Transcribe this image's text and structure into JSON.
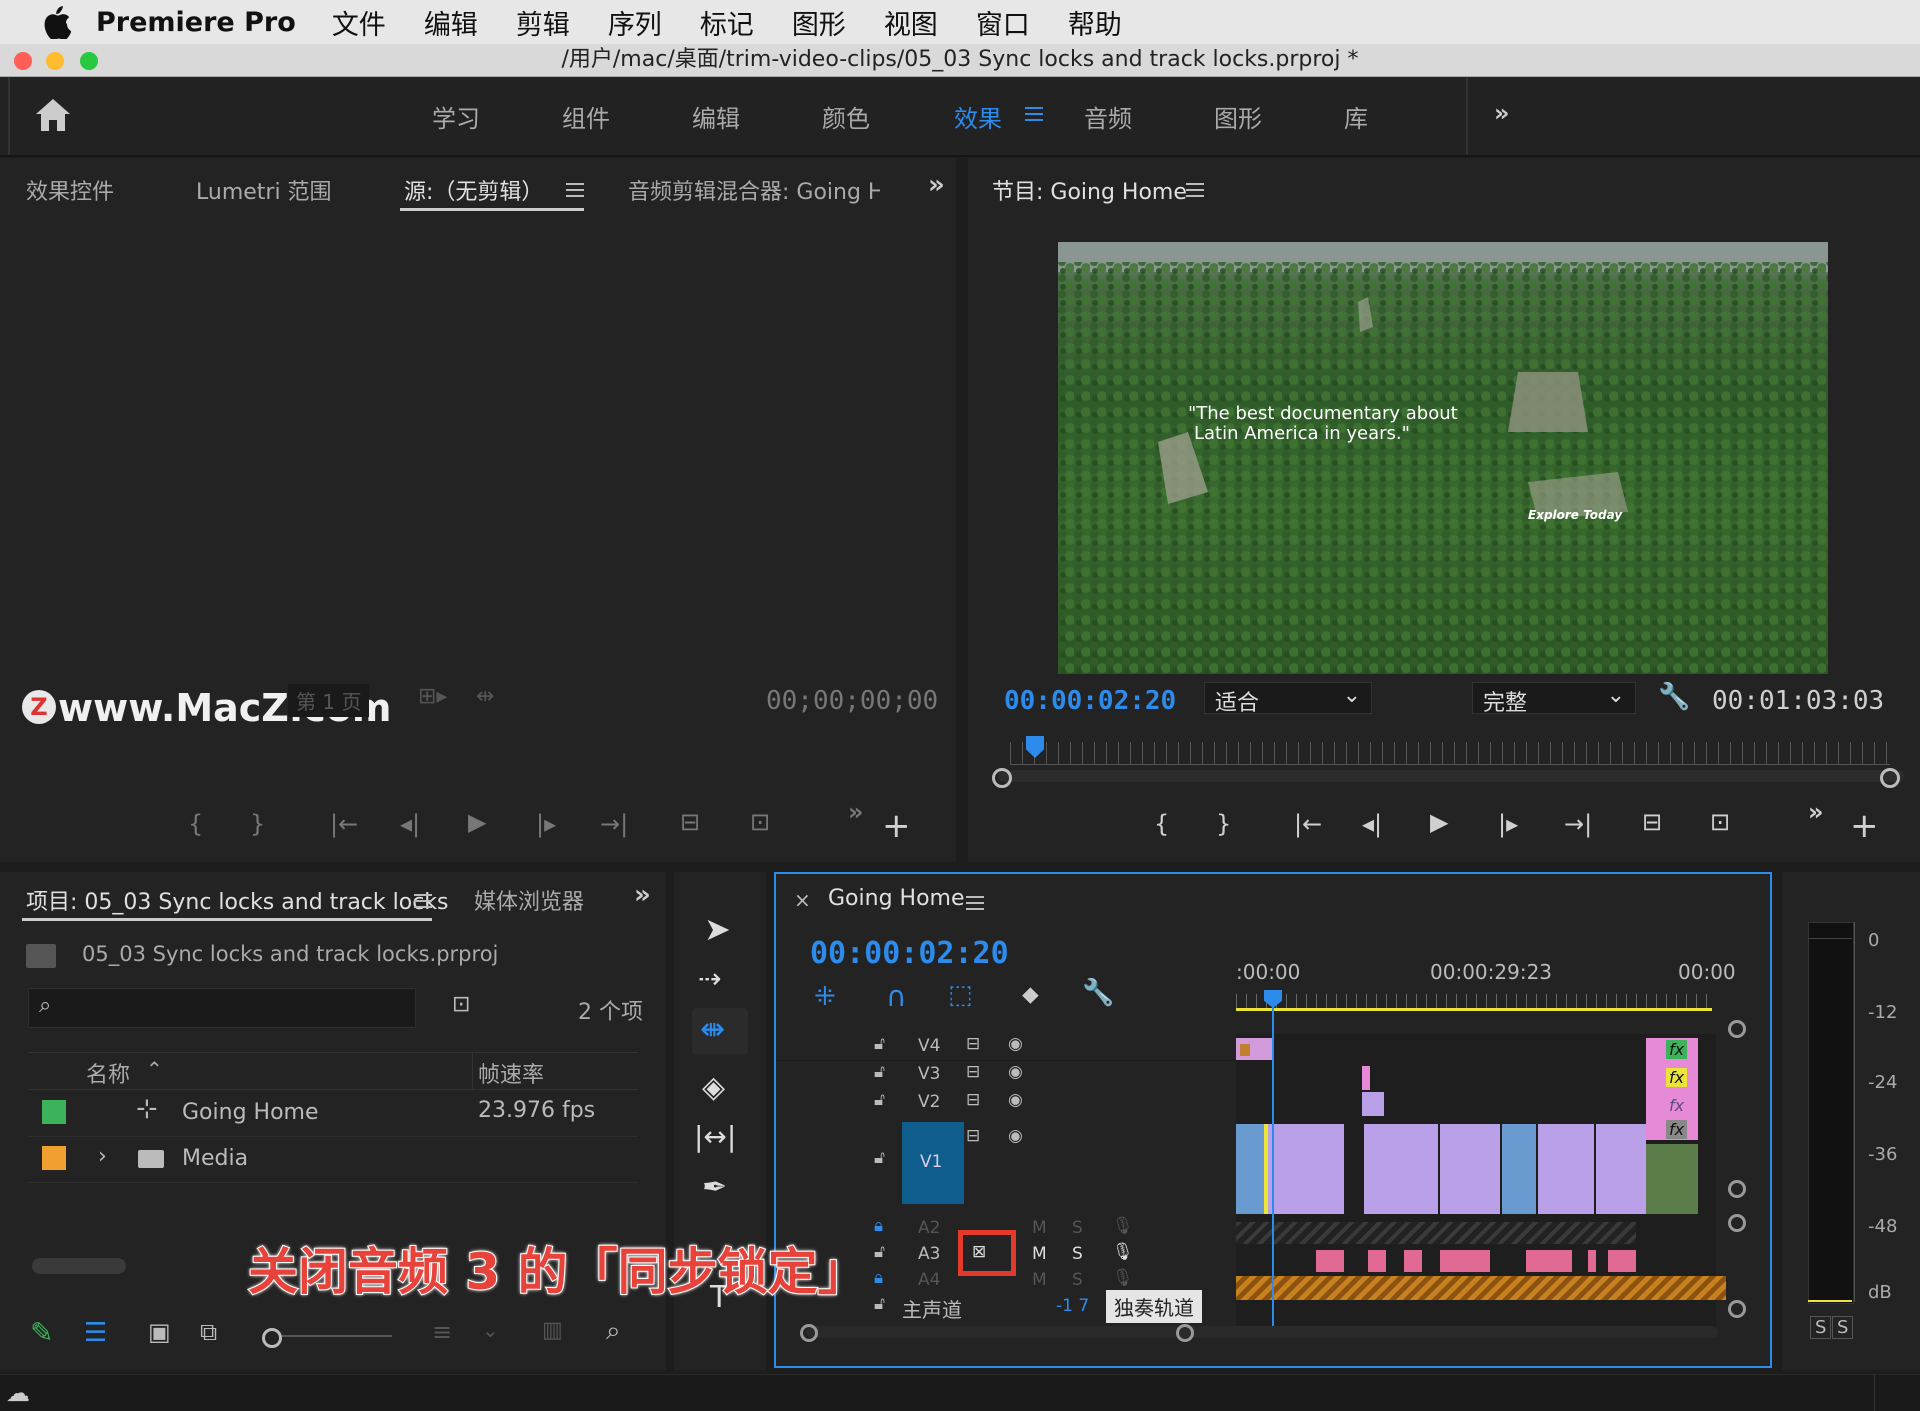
{
  "menubar": {
    "app_name": "Premiere Pro",
    "items": [
      "文件",
      "编辑",
      "剪辑",
      "序列",
      "标记",
      "图形",
      "视图",
      "窗口",
      "帮助"
    ]
  },
  "window": {
    "title": "/用户/mac/桌面/trim-video-clips/05_03 Sync locks and track locks.prproj *"
  },
  "workspaces": {
    "items": [
      "学习",
      "组件",
      "编辑",
      "颜色",
      "效果",
      "音频",
      "图形",
      "库"
    ],
    "active": "效果"
  },
  "source_panel": {
    "tabs": [
      "效果控件",
      "Lumetri 范围",
      "源:（无剪辑）",
      "音频剪辑混合器: Going H"
    ],
    "active_tab": "源:（无剪辑）",
    "timecode_left": "00;00;00;00",
    "page_label": "第 1 页",
    "timecode_right": "00;00;00;00",
    "watermark": "www.MacZ.com"
  },
  "program_panel": {
    "title": "节目: Going Home",
    "overlay_text_line1": "\"The best documentary about",
    "overlay_text_line2": "Latin America in years.\"",
    "overlay_small": "Explore Today",
    "timecode": "00:00:02:20",
    "fit_value": "适合",
    "quality_value": "完整",
    "duration": "00:01:03:03"
  },
  "project_panel": {
    "tabs": [
      "项目: 05_03 Sync locks and track locks",
      "媒体浏览器"
    ],
    "file_name": "05_03 Sync locks and track locks.prproj",
    "item_count": "2 个项",
    "col_name": "名称",
    "col_fps": "帧速率",
    "rows": [
      {
        "name": "Going Home",
        "fps": "23.976 fps",
        "color": "#3cb35a"
      },
      {
        "name": "Media",
        "fps": "",
        "color": "#f0a030"
      }
    ]
  },
  "timeline": {
    "title": "Going Home",
    "timecode": "00:00:02:20",
    "ruler": [
      ":00:00",
      "00:00:29:23",
      "00:00"
    ],
    "tracks_video": [
      "V4",
      "V3",
      "V2",
      "V1"
    ],
    "tracks_audio": [
      "A2",
      "A3",
      "A4"
    ],
    "mute": "M",
    "solo": "S",
    "master": "主声道",
    "master_value": "-1 7",
    "tooltip": "独奏轨道"
  },
  "meter": {
    "scale": [
      "0",
      "-12",
      "-24",
      "-36",
      "-48",
      "dB"
    ],
    "solo_left": "S",
    "solo_right": "S"
  },
  "annotation": {
    "text": "关闭音频 3 的「同步锁定」"
  }
}
